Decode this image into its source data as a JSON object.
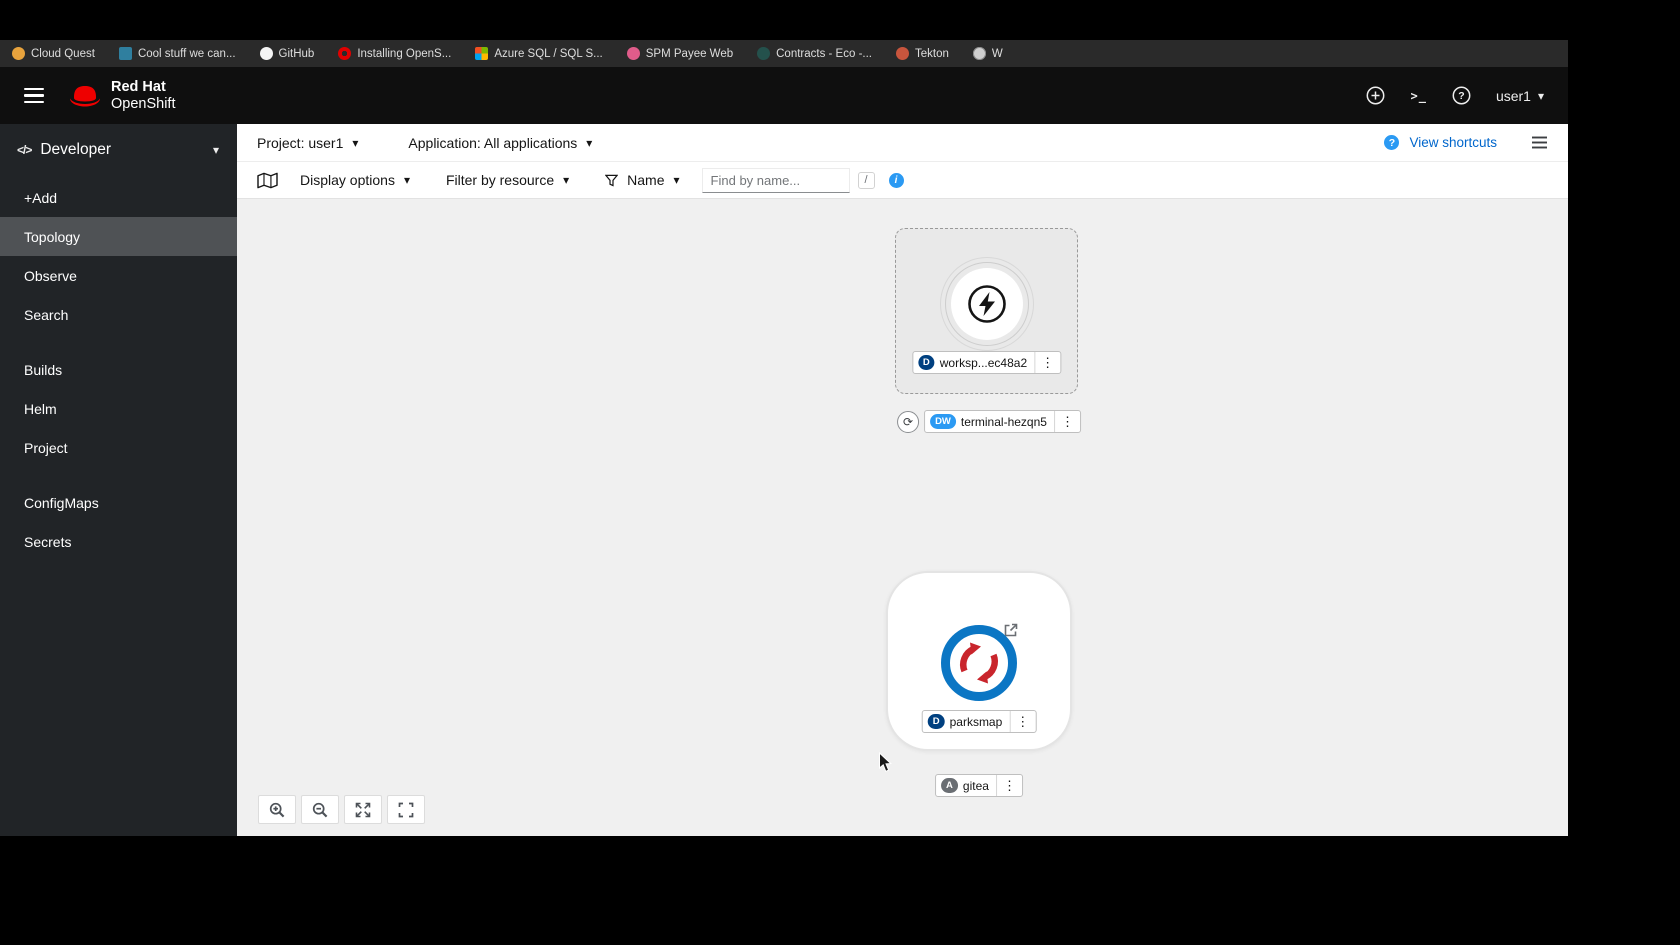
{
  "browser": {
    "bookmarks": [
      {
        "label": "Cloud Quest",
        "icon": "cloud-quest-favicon"
      },
      {
        "label": "Cool stuff we can...",
        "icon": "window-favicon"
      },
      {
        "label": "GitHub",
        "icon": "github-favicon"
      },
      {
        "label": "Installing OpenS...",
        "icon": "openshift-favicon"
      },
      {
        "label": "Azure SQL / SQL S...",
        "icon": "azure-favicon"
      },
      {
        "label": "SPM Payee Web",
        "icon": "spm-favicon"
      },
      {
        "label": "Contracts - Eco -...",
        "icon": "contracts-favicon"
      },
      {
        "label": "Tekton",
        "icon": "tekton-favicon"
      },
      {
        "label": "W",
        "icon": "globe-favicon"
      }
    ]
  },
  "masthead": {
    "brand_top": "Red Hat",
    "brand_bottom": "OpenShift",
    "username": "user1"
  },
  "sidebar": {
    "perspective": "Developer",
    "selected_item": "Topology",
    "groups": [
      [
        "+Add",
        "Topology",
        "Observe",
        "Search"
      ],
      [
        "Builds",
        "Helm",
        "Project"
      ],
      [
        "ConfigMaps",
        "Secrets"
      ]
    ]
  },
  "context_bar": {
    "project": "Project: user1",
    "application": "Application: All applications",
    "view_shortcuts": "View shortcuts"
  },
  "toolbar": {
    "display_options": "Display options",
    "filter_by_resource": "Filter by resource",
    "name_filter": "Name",
    "find_placeholder": "Find by name...",
    "find_shortcut": "/"
  },
  "topology": {
    "workspace": {
      "badge": "D",
      "label": "worksp...ec48a2"
    },
    "terminal": {
      "badge": "DW",
      "label": "terminal-hezqn5"
    },
    "parksmap": {
      "badge": "D",
      "label": "parksmap"
    },
    "gitea": {
      "badge": "A",
      "label": "gitea"
    }
  },
  "colors": {
    "link_blue": "#0066cc",
    "info_blue": "#2b9af3",
    "badge_navy": "#004080",
    "badge_lightblue": "#2b9af3",
    "badge_gray": "#6a6e73",
    "canvas_bg": "#f0f0f0",
    "sidebar_bg": "#212427",
    "sidebar_selected": "#4f5255",
    "masthead_bg": "#0f0f0f"
  }
}
